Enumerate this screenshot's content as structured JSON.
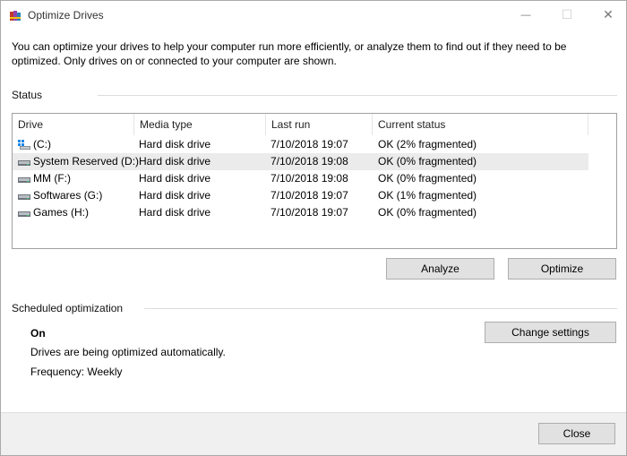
{
  "window": {
    "title": "Optimize Drives",
    "minimize_glyph": "—",
    "maximize_glyph": "☐",
    "close_glyph": "✕"
  },
  "description": "You can optimize your drives to help your computer run more efficiently, or analyze them to find out if they need to be optimized. Only drives on or connected to your computer are shown.",
  "status": {
    "label": "Status",
    "columns": [
      "Drive",
      "Media type",
      "Last run",
      "Current status"
    ],
    "drives": [
      {
        "name": "(C:)",
        "media": "Hard disk drive",
        "last_run": "7/10/2018 19:07",
        "status": "OK (2% fragmented)",
        "icon": "windows-drive-icon",
        "selected": false
      },
      {
        "name": "System Reserved (D:)",
        "media": "Hard disk drive",
        "last_run": "7/10/2018 19:08",
        "status": "OK (0% fragmented)",
        "icon": "hard-drive-icon",
        "selected": true
      },
      {
        "name": "MM (F:)",
        "media": "Hard disk drive",
        "last_run": "7/10/2018 19:08",
        "status": "OK (0% fragmented)",
        "icon": "hard-drive-icon",
        "selected": false
      },
      {
        "name": "Softwares (G:)",
        "media": "Hard disk drive",
        "last_run": "7/10/2018 19:07",
        "status": "OK (1% fragmented)",
        "icon": "hard-drive-icon",
        "selected": false
      },
      {
        "name": "Games (H:)",
        "media": "Hard disk drive",
        "last_run": "7/10/2018 19:07",
        "status": "OK (0% fragmented)",
        "icon": "hard-drive-icon",
        "selected": false
      }
    ],
    "analyze_label": "Analyze",
    "optimize_label": "Optimize"
  },
  "schedule": {
    "label": "Scheduled optimization",
    "state": "On",
    "line1": "Drives are being optimized automatically.",
    "line2": "Frequency: Weekly",
    "change_label": "Change settings"
  },
  "footer": {
    "close_label": "Close"
  },
  "colors": {
    "selected_row": "#ebebeb",
    "button_face": "#e1e1e1",
    "footer_bg": "#f0f0f0"
  }
}
